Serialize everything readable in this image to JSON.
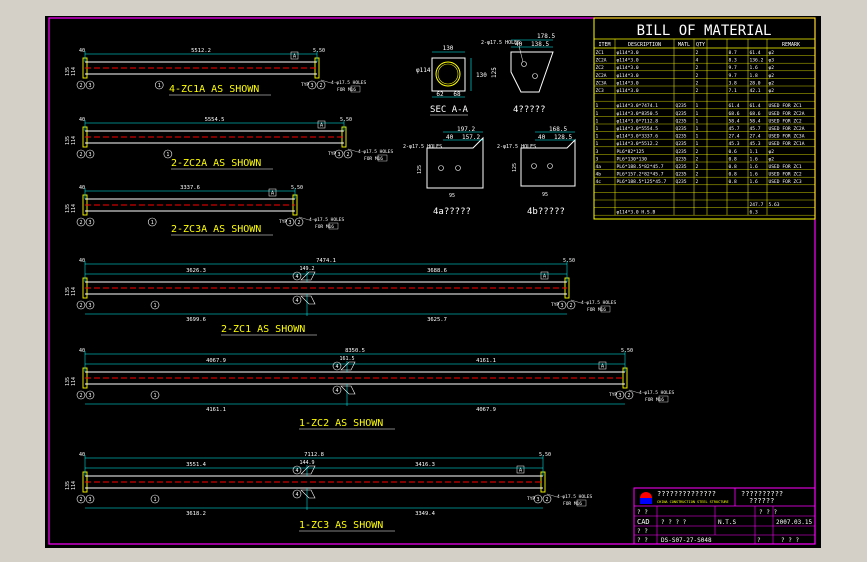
{
  "bom": {
    "title": "BILL OF MATERIAL",
    "headers": [
      "ITEM",
      "DESCRIPTION",
      "MATL",
      "QTY",
      "",
      "",
      "",
      "REMARK"
    ],
    "rows": [
      [
        "ZC1",
        "φ114*3.0",
        "",
        "2",
        "8.7",
        "61.4",
        "φ2"
      ],
      [
        "ZC2A",
        "φ114*3.0",
        "",
        "4",
        "8.3",
        "136.2",
        "φ3"
      ],
      [
        "ZC2",
        "φ114*3.0",
        "",
        "2",
        "9.7",
        "1.6",
        "φ2"
      ],
      [
        "ZC2A",
        "φ114*3.0",
        "",
        "2",
        "9.7",
        "1.8",
        "φ2"
      ],
      [
        "ZC3A",
        "φ114*3.0",
        "",
        "2",
        "3.8",
        "28.0",
        "φ2"
      ],
      [
        "ZC3",
        "φ114*3.0",
        "",
        "2",
        "7.1",
        "42.1",
        "φ2"
      ],
      [
        "",
        "",
        "",
        "",
        "",
        "",
        ""
      ],
      [
        "1",
        "φ114*3.0*7474.1",
        "Q235",
        "1",
        "61.4",
        "61.4",
        "USED FOR ZC1"
      ],
      [
        "1",
        "φ114*3.0*8350.5",
        "Q235",
        "1",
        "68.6",
        "68.6",
        "USED FOR ZC2A"
      ],
      [
        "1",
        "φ114*3.0*7112.8",
        "Q235",
        "1",
        "58.4",
        "58.4",
        "USED FOR ZC2"
      ],
      [
        "1",
        "φ114*3.0*5554.5",
        "Q235",
        "1",
        "45.7",
        "45.7",
        "USED FOR ZC2A"
      ],
      [
        "1",
        "φ114*3.0*3337.6",
        "Q235",
        "1",
        "27.4",
        "27.4",
        "USED FOR ZC3A"
      ],
      [
        "1",
        "φ114*3.0*5512.2",
        "Q235",
        "1",
        "45.3",
        "45.3",
        "USED FOR ZC1A"
      ],
      [
        "3",
        "PL6*82*125",
        "Q235",
        "2",
        "0.6",
        "1.1",
        "φ2"
      ],
      [
        "3",
        "PL6*130*130",
        "Q235",
        "2",
        "0.8",
        "1.6",
        "φ2"
      ],
      [
        "4a",
        "PL6*188.5*82*45.7",
        "Q235",
        "2",
        "0.8",
        "1.6",
        "USED FOR ZC1"
      ],
      [
        "4b",
        "PL6*157.2*82*45.7",
        "Q235",
        "2",
        "0.8",
        "1.6",
        "USED FOR ZC2"
      ],
      [
        "4c",
        "PL6*188.5*125*45.7",
        "Q235",
        "2",
        "0.8",
        "1.6",
        "USED FOR ZC3"
      ],
      [
        "",
        "",
        "",
        "",
        "",
        "",
        ""
      ],
      [
        "",
        "",
        "",
        "",
        "",
        "",
        ""
      ],
      [
        "",
        "",
        "",
        "",
        "",
        "247.7",
        "5.63"
      ],
      [
        "",
        "φ114*3.0 H.S.B",
        "",
        "",
        "",
        "6.3",
        ""
      ]
    ]
  },
  "views": [
    {
      "label": "4-ZC1A  AS  SHOWN",
      "dim": "5512.2"
    },
    {
      "label": "2-ZC2A  AS  SHOWN",
      "dim": "5554.5"
    },
    {
      "label": "2-ZC3A  AS  SHOWN",
      "dim": "3337.6"
    },
    {
      "label": "2-ZC1  AS  SHOWN",
      "dim": "7474.1",
      "left": "3626.3",
      "right": "3688.6",
      "bleft": "3699.6",
      "bright": "3625.7",
      "mid": "149.2"
    },
    {
      "label": "1-ZC2  AS  SHOWN",
      "dim": "8350.5",
      "left": "4067.9",
      "right": "4161.1",
      "bleft": "4161.1",
      "bright": "4067.9",
      "mid": "161.5"
    },
    {
      "label": "1-ZC3  AS  SHOWN",
      "dim": "7112.8",
      "left": "3551.4",
      "right": "3416.3",
      "bleft": "3618.2",
      "bright": "3349.4",
      "mid": "144.9"
    }
  ],
  "details": {
    "sec_label": "SEC  A-A",
    "sec_dim_top": "130",
    "sec_dim_side": "130",
    "sec_pipe": "φ114",
    "sec_b1": "62",
    "sec_b2": "68",
    "d4_label": "4?????",
    "d4_dim1": "178.5",
    "d4_dim2": "40",
    "d4_dim3": "138.5",
    "d4_side": "125",
    "d4a_label": "4a?????",
    "d4a_dim1": "197.2",
    "d4a_dim2": "40",
    "d4a_dim3": "157.2",
    "d4b_label": "4b?????",
    "d4b_dim1": "168.5",
    "d4b_dim2": "40",
    "d4b_dim3": "128.5",
    "small_125": "125",
    "small_95": "95",
    "holes": "2-φ17.5 HOLES",
    "typ": "TYP",
    "holes4": "4-φ17.5 HOLES",
    "for_m": "FOR M16"
  },
  "titleblock": {
    "company": "??????????????",
    "company_en": "CHINA CONSTRUCTION STEEL STRUCTURE",
    "project": "??????????",
    "project2": "??????",
    "cad": "CAD",
    "nts": "N.T.S",
    "date": "2007.03.15",
    "drawing_no": "DS-S07-27-S048",
    "q": "?",
    "qq": "? ?",
    "qqq": "? ? ?",
    "qqqq": "? ? ? ?"
  },
  "colors": {
    "bg": "#000000",
    "white": "#ffffff",
    "yellow": "#ffff00",
    "cyan": "#00ffff",
    "red": "#ff0000",
    "magenta": "#ff00ff",
    "green": "#00ff00",
    "blue": "#0000ff"
  }
}
